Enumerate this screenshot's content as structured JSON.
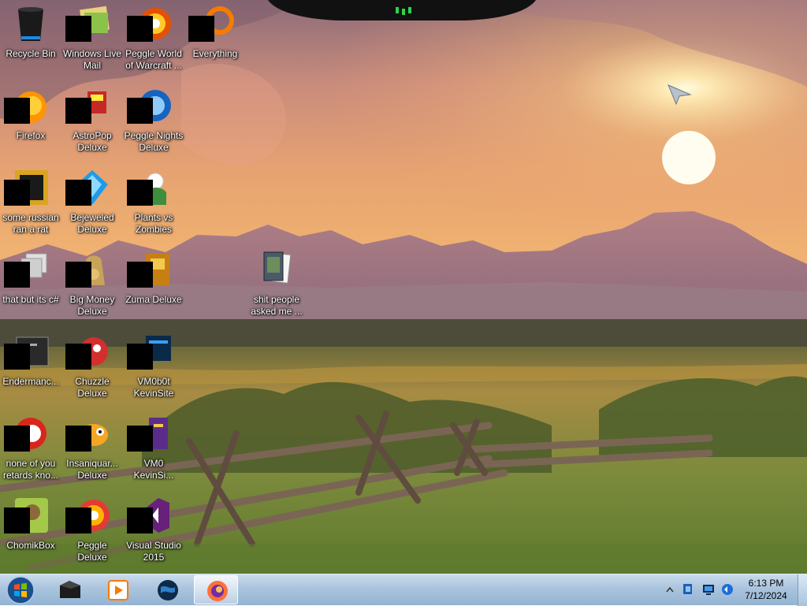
{
  "desktop": {
    "icons": [
      {
        "label": "Recycle Bin",
        "icon": "recycle-bin-icon"
      },
      {
        "label": "Windows Live Mail",
        "icon": "mail-icon"
      },
      {
        "label": "Peggle World of Warcraft ...",
        "icon": "peggle-icon"
      },
      {
        "label": "Everything",
        "icon": "search-app-icon"
      },
      {
        "label": "Firefox",
        "icon": "firefox-icon"
      },
      {
        "label": "AstroPop Deluxe",
        "icon": "astropop-icon"
      },
      {
        "label": "Peggle Nights Deluxe",
        "icon": "peggle-nights-icon"
      },
      {
        "label": "some russian ran a rat",
        "icon": "java-app-icon"
      },
      {
        "label": "Bejeweled Deluxe",
        "icon": "bejeweled-icon"
      },
      {
        "label": "Plants vs Zombies",
        "icon": "plants-vs-zombies-icon"
      },
      {
        "label": "that but its c#",
        "icon": "shortcut-icon"
      },
      {
        "label": "Big Money Deluxe",
        "icon": "big-money-icon"
      },
      {
        "label": "Zuma Deluxe",
        "icon": "zuma-icon"
      },
      {
        "label": "shit people asked me ...",
        "icon": "folder-icon"
      },
      {
        "label": "Endermanc...",
        "icon": "terminal-icon"
      },
      {
        "label": "Chuzzle Deluxe",
        "icon": "chuzzle-icon"
      },
      {
        "label": "VM0b0t KevinSite",
        "icon": "vm-icon"
      },
      {
        "label": "none of you retards kno...",
        "icon": "opera-icon"
      },
      {
        "label": "Insaniquar... Deluxe",
        "icon": "insaniquarium-icon"
      },
      {
        "label": "VM0 KevinSi...",
        "icon": "vm-icon-2"
      },
      {
        "label": "ChomikBox",
        "icon": "chomikbox-icon"
      },
      {
        "label": "Peggle Deluxe",
        "icon": "peggle-deluxe-icon"
      },
      {
        "label": "Visual Studio 2015",
        "icon": "visual-studio-icon"
      }
    ]
  },
  "taskbar": {
    "start": {
      "icon": "windows-start-icon"
    },
    "pinned": [
      {
        "icon": "terminal-app-icon"
      },
      {
        "icon": "media-player-icon"
      },
      {
        "icon": "globe-icon"
      },
      {
        "icon": "firefox-icon",
        "active": true
      }
    ],
    "tray": {
      "icons": [
        "show-hidden-icons-chevron",
        "security-icon",
        "network-icon",
        "volume-icon"
      ],
      "time": "6:13 PM",
      "date": "7/12/2024"
    }
  },
  "colors": {
    "taskbar_top": "#c9dbec",
    "taskbar_bottom": "#93b3d3",
    "sky_top": "#a57a83",
    "sun": "#fff6c8"
  }
}
